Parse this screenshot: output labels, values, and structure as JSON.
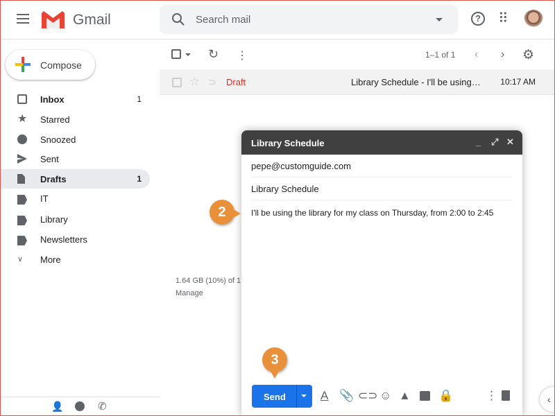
{
  "header": {
    "app_name": "Gmail",
    "search_placeholder": "Search mail"
  },
  "compose_label": "Compose",
  "sidebar": {
    "items": [
      {
        "label": "Inbox",
        "count": "1",
        "icon": "inbox-icon"
      },
      {
        "label": "Starred",
        "count": "",
        "icon": "star-icon"
      },
      {
        "label": "Snoozed",
        "count": "",
        "icon": "clock-icon"
      },
      {
        "label": "Sent",
        "count": "",
        "icon": "send-icon"
      },
      {
        "label": "Drafts",
        "count": "1",
        "icon": "draft-icon"
      },
      {
        "label": "IT",
        "count": "",
        "icon": "label-icon"
      },
      {
        "label": "Library",
        "count": "",
        "icon": "label-icon"
      },
      {
        "label": "Newsletters",
        "count": "",
        "icon": "label-icon"
      },
      {
        "label": "More",
        "count": "",
        "icon": "chevron-down-icon"
      }
    ]
  },
  "toolbar": {
    "pagination": "1–1 of 1"
  },
  "messages": [
    {
      "sender": "Draft",
      "subject": "Library Schedule - I'll be using…",
      "time": "10:17 AM"
    }
  ],
  "storage": {
    "usage": "1.64 GB (10%) of 1",
    "manage": "Manage"
  },
  "compose": {
    "title": "Library Schedule",
    "to": "pepe@customguide.com",
    "subject": "Library Schedule",
    "body": "I'll be using the library for my class on Thursday, from 2:00 to 2:45",
    "send_label": "Send"
  },
  "callouts": [
    "2",
    "3"
  ],
  "colors": {
    "accent": "#1a73e8",
    "draft": "#d93025",
    "callout": "#e8913a"
  }
}
